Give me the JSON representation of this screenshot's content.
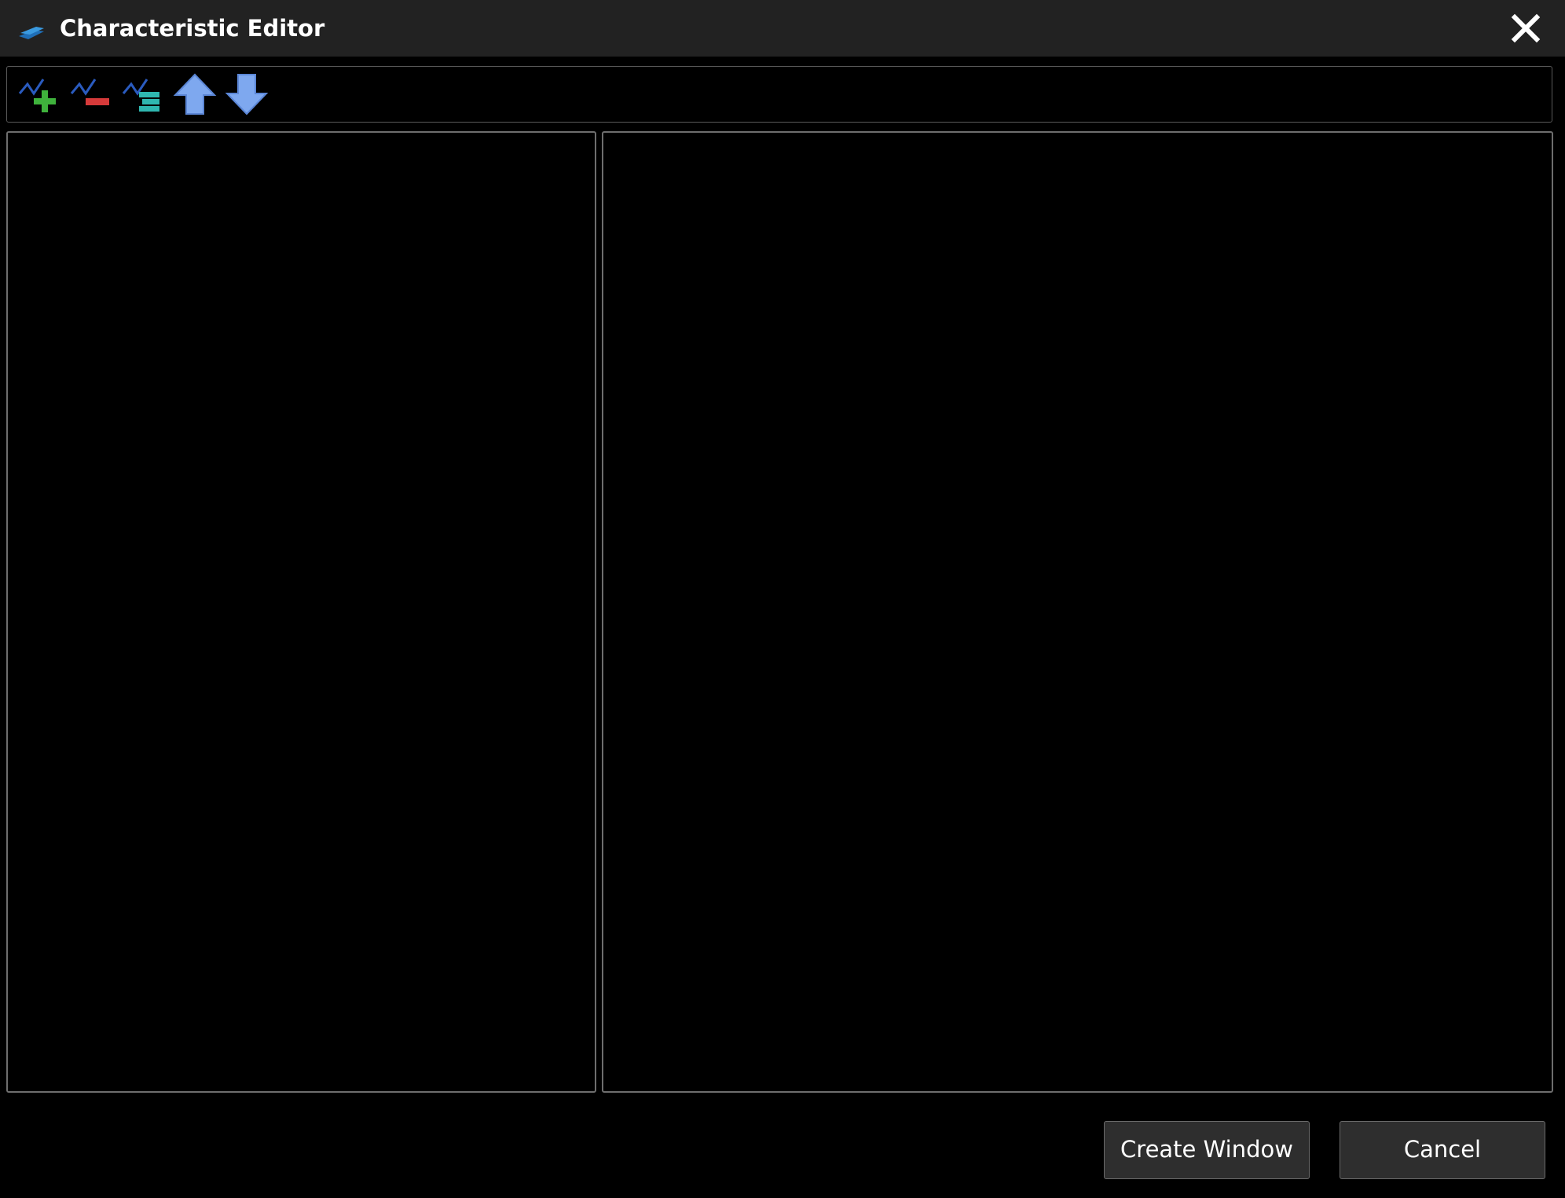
{
  "window": {
    "title": "Characteristic Editor",
    "app_icon": "layers-icon",
    "close_icon": "close-icon"
  },
  "toolbar": {
    "buttons": [
      {
        "icon": "add-characteristic-icon"
      },
      {
        "icon": "remove-characteristic-icon"
      },
      {
        "icon": "edit-characteristic-icon"
      },
      {
        "icon": "move-up-icon"
      },
      {
        "icon": "move-down-icon"
      }
    ]
  },
  "footer": {
    "create_label": "Create Window",
    "cancel_label": "Cancel"
  },
  "colors": {
    "titlebar": "#222222",
    "background": "#000000",
    "button_bg": "#2e2e2e",
    "arrow_blue": "#7ea8ef",
    "add_green": "#3fb23c",
    "remove_red": "#d63a3a",
    "edit_teal": "#2fb7b0"
  }
}
